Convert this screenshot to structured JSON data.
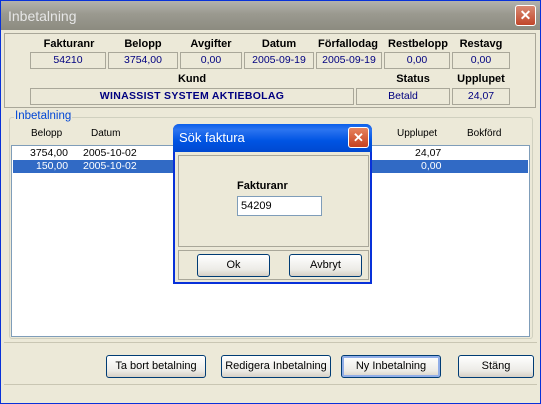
{
  "window": {
    "title": "Inbetalning",
    "close_glyph": "✕"
  },
  "invoice": {
    "headers": [
      "Fakturanr",
      "Belopp",
      "Avgifter",
      "Datum",
      "Förfallodag",
      "Restbelopp",
      "Restavg"
    ],
    "values": [
      "54210",
      "3754,00",
      "0,00",
      "2005-09-19",
      "2005-09-19",
      "0,00",
      "0,00"
    ]
  },
  "customer": {
    "kund_label": "Kund",
    "kund_value": "WINASSIST SYSTEM AKTIEBOLAG",
    "status_label": "Status",
    "status_value": "Betald",
    "upplupet_label": "Upplupet",
    "upplupet_value": "24,07"
  },
  "payments": {
    "group_label": "Inbetalning",
    "columns": {
      "belopp": "Belopp",
      "datum": "Datum",
      "upplupet": "Upplupet",
      "bokford": "Bokförd"
    },
    "rows": [
      {
        "belopp": "3754,00",
        "datum": "2005-10-02",
        "upplupet": "24,07",
        "bokford": "",
        "selected": false
      },
      {
        "belopp": "150,00",
        "datum": "2005-10-02",
        "upplupet": "0,00",
        "bokford": "",
        "selected": true
      }
    ]
  },
  "buttons": {
    "delete": "Ta bort betalning",
    "edit": "Redigera Inbetalning",
    "new": "Ny Inbetalning",
    "close": "Stäng"
  },
  "dialog": {
    "title": "Sök faktura",
    "close_glyph": "✕",
    "label": "Fakturanr",
    "input_value": "54209",
    "ok": "Ok",
    "cancel": "Avbryt"
  },
  "colors": {
    "selection": "#316ac5",
    "value_text": "#000080",
    "group_label": "#0046d5"
  }
}
